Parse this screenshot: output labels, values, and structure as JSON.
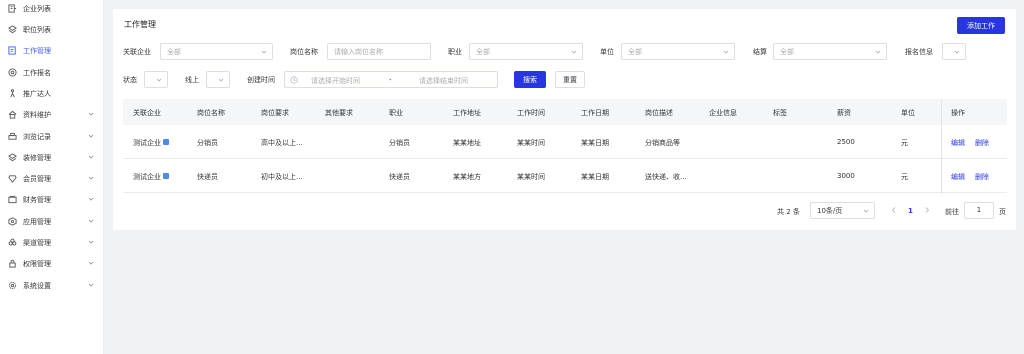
{
  "sidebar": {
    "items": [
      {
        "label": "企业列表",
        "icon": "building-icon",
        "has_chevron": false,
        "active": false
      },
      {
        "label": "职位列表",
        "icon": "layers-icon",
        "has_chevron": false,
        "active": false
      },
      {
        "label": "工作管理",
        "icon": "document-edit-icon",
        "has_chevron": false,
        "active": true
      },
      {
        "label": "工作报名",
        "icon": "at-sign-icon",
        "has_chevron": false,
        "active": false
      },
      {
        "label": "推广达人",
        "icon": "person-walk-icon",
        "has_chevron": false,
        "active": false
      },
      {
        "label": "资料维护",
        "icon": "home-icon",
        "has_chevron": true,
        "active": false
      },
      {
        "label": "浏览记录",
        "icon": "printer-icon",
        "has_chevron": true,
        "active": false
      },
      {
        "label": "装修管理",
        "icon": "layers-icon",
        "has_chevron": true,
        "active": false
      },
      {
        "label": "会员管理",
        "icon": "diamond-icon",
        "has_chevron": true,
        "active": false
      },
      {
        "label": "财务管理",
        "icon": "wallet-icon",
        "has_chevron": true,
        "active": false
      },
      {
        "label": "应用管理",
        "icon": "hexagon-icon",
        "has_chevron": true,
        "active": false
      },
      {
        "label": "渠道管理",
        "icon": "clover-icon",
        "has_chevron": true,
        "active": false
      },
      {
        "label": "权限管理",
        "icon": "lock-icon",
        "has_chevron": true,
        "active": false
      },
      {
        "label": "系统设置",
        "icon": "gear-icon",
        "has_chevron": true,
        "active": false
      }
    ],
    "accent_color": "#3d5afe"
  },
  "header": {
    "title": "工作管理",
    "add_button": "添加工作"
  },
  "filters": {
    "company_label": "关联企业",
    "company_value": "全部",
    "position_label": "岗位名称",
    "position_placeholder": "请输入岗位名称",
    "job_label": "职业",
    "job_value": "全部",
    "unit_label": "单位",
    "unit_value": "全部",
    "settle_label": "结算",
    "settle_value": "全部",
    "signup_label": "报名信息",
    "status_label": "状态",
    "online_label": "线上",
    "created_label": "创建时间",
    "start_placeholder": "请选择开始时间",
    "range_sep": "-",
    "end_placeholder": "请选择结束时间",
    "search_button": "搜索",
    "reset_button": "重置"
  },
  "table": {
    "columns": [
      "关联企业",
      "岗位名称",
      "岗位要求",
      "其他要求",
      "职业",
      "工作地址",
      "工作时间",
      "工作日期",
      "岗位描述",
      "企业信息",
      "标签",
      "薪资",
      "单位",
      "操作"
    ],
    "rows": [
      {
        "company": "测试企业",
        "position": "分销员",
        "requirement": "高中及以上...",
        "other": "",
        "job": "分销员",
        "address": "某某地址",
        "time": "某某时间",
        "date": "某某日期",
        "description": "分销商品等",
        "company_info": "",
        "tag": "",
        "salary": "2500",
        "unit": "元",
        "edit": "编辑",
        "delete": "删除"
      },
      {
        "company": "测试企业",
        "position": "快递员",
        "requirement": "初中及以上...",
        "other": "",
        "job": "快递员",
        "address": "某某地方",
        "time": "某某时间",
        "date": "某某日期",
        "description": "送快递、收...",
        "company_info": "",
        "tag": "",
        "salary": "3000",
        "unit": "元",
        "edit": "编辑",
        "delete": "删除"
      }
    ]
  },
  "pagination": {
    "total": "共 2 条",
    "page_size": "10条/页",
    "current_page": "1",
    "goto_label": "前往",
    "goto_value": "1",
    "goto_unit": "页"
  },
  "colors": {
    "primary": "#2836e0",
    "background": "#f0f2f5"
  }
}
